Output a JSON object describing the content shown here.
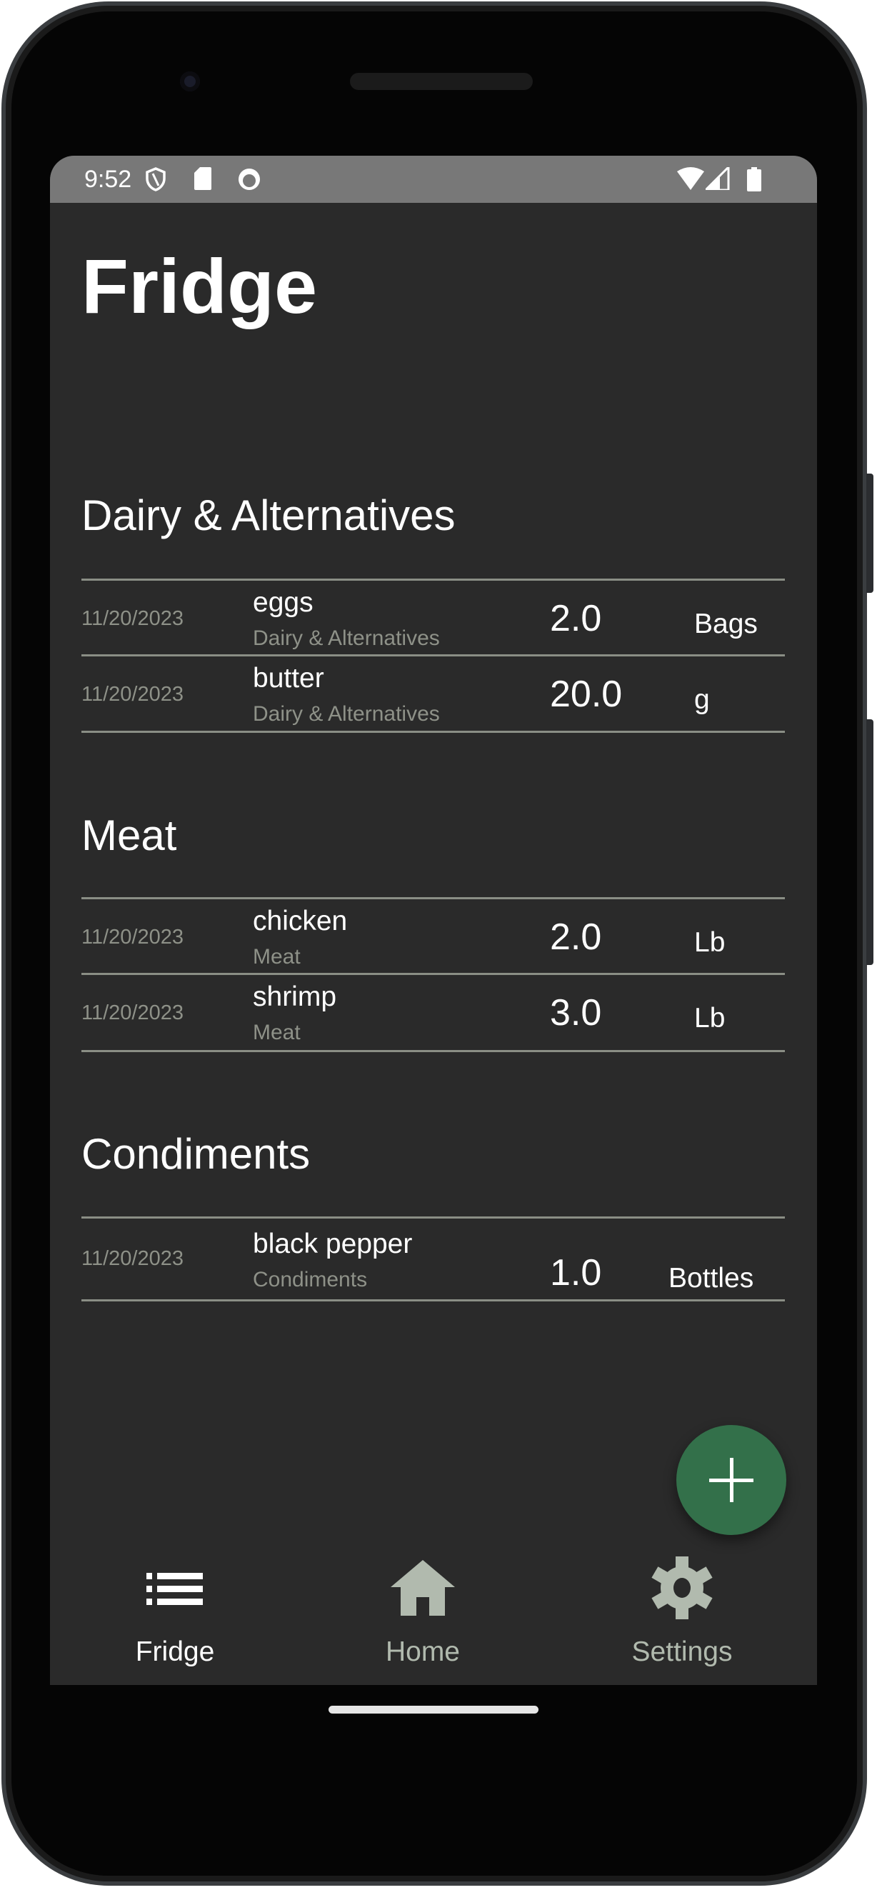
{
  "status_bar": {
    "time": "9:52"
  },
  "header": {
    "title": "Fridge"
  },
  "sections": [
    {
      "title": "Dairy & Alternatives",
      "items": [
        {
          "date": "11/20/2023",
          "name": "eggs",
          "category": "Dairy & Alternatives",
          "quantity": "2.0",
          "unit": "Bags"
        },
        {
          "date": "11/20/2023",
          "name": "butter",
          "category": "Dairy & Alternatives",
          "quantity": "20.0",
          "unit": "g"
        }
      ]
    },
    {
      "title": "Meat",
      "items": [
        {
          "date": "11/20/2023",
          "name": "chicken",
          "category": "Meat",
          "quantity": "2.0",
          "unit": "Lb"
        },
        {
          "date": "11/20/2023",
          "name": "shrimp",
          "category": "Meat",
          "quantity": "3.0",
          "unit": "Lb"
        }
      ]
    },
    {
      "title": "Condiments",
      "items": [
        {
          "date": "11/20/2023",
          "name": "black pepper",
          "category": "Condiments",
          "quantity": "1.0",
          "unit": "Bottles"
        }
      ]
    }
  ],
  "fab": {
    "icon": "plus-icon"
  },
  "bottom_nav": [
    {
      "label": "Fridge",
      "icon": "list-icon",
      "active": true
    },
    {
      "label": "Home",
      "icon": "home-icon",
      "active": false
    },
    {
      "label": "Settings",
      "icon": "gear-icon",
      "active": false
    }
  ],
  "colors": {
    "background": "#2a2a2a",
    "accent": "#33704a",
    "divider": "#8a8e85",
    "muted_text": "#8e9188",
    "nav_inactive": "#b1baae"
  }
}
